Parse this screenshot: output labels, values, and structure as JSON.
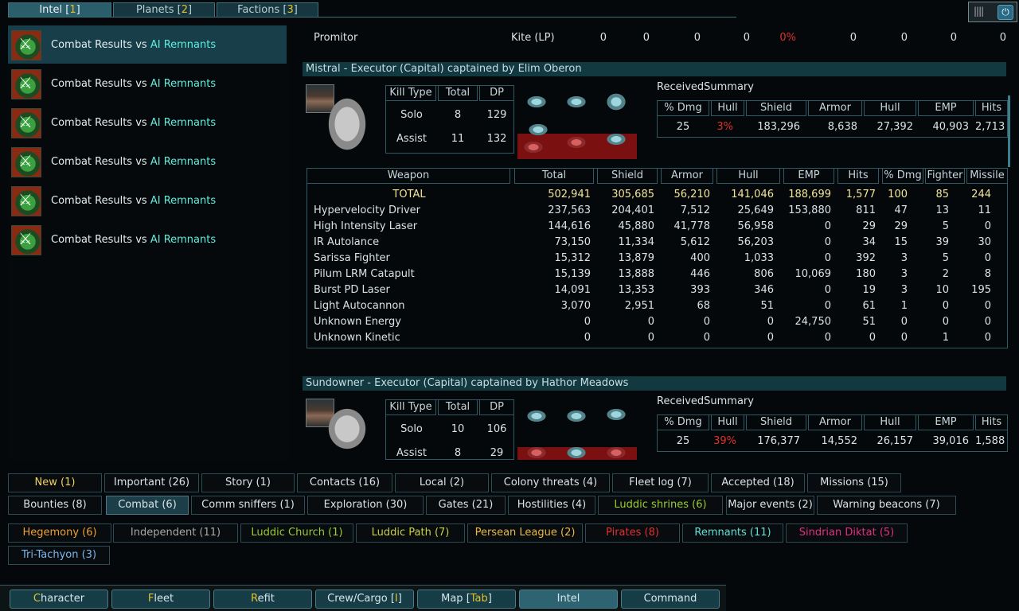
{
  "top_tabs": [
    {
      "label": "Intel [",
      "key": "1",
      "end": "]"
    },
    {
      "label": "Planets [",
      "key": "2",
      "end": "]"
    },
    {
      "label": "Factions [",
      "key": "3",
      "end": "]"
    }
  ],
  "intel_list": [
    {
      "prefix": "Combat Results vs ",
      "faction": "AI Remnants"
    },
    {
      "prefix": "Combat Results vs ",
      "faction": "AI Remnants"
    },
    {
      "prefix": "Combat Results vs ",
      "faction": "AI Remnants"
    },
    {
      "prefix": "Combat Results vs ",
      "faction": "AI Remnants"
    },
    {
      "prefix": "Combat Results vs ",
      "faction": "AI Remnants"
    },
    {
      "prefix": "Combat Results vs ",
      "faction": "AI Remnants"
    }
  ],
  "prev_row": {
    "name": "Promitor",
    "hull": "Kite (LP)",
    "v1": "0",
    "v2": "0",
    "v3": "0",
    "v4": "0",
    "pct": "0%",
    "v5": "0",
    "v6": "0",
    "v7": "0",
    "v8": "0"
  },
  "ship1": {
    "title": "Mistral - Executor (Capital) captained by Elim Oberon",
    "kill_headers": [
      "Kill Type",
      "Total",
      "DP"
    ],
    "kills": [
      {
        "type": "Solo",
        "total": "8",
        "dp": "129"
      },
      {
        "type": "Assist",
        "total": "11",
        "dp": "132"
      }
    ],
    "received_title": "ReceivedSummary",
    "received_headers": [
      "% Dmg",
      "Hull",
      "Shield",
      "Armor",
      "Hull",
      "EMP",
      "Hits"
    ],
    "received": [
      "25",
      "3%",
      "183,296",
      "8,638",
      "27,392",
      "40,903",
      "2,713"
    ],
    "weapon_headers": [
      "Weapon",
      "Total",
      "Shield",
      "Armor",
      "Hull",
      "EMP",
      "Hits",
      "% Dmg",
      "Fighter",
      "Missile"
    ],
    "weapons": [
      [
        "TOTAL",
        "502,941",
        "305,685",
        "56,210",
        "141,046",
        "188,699",
        "1,577",
        "100",
        "85",
        "244"
      ],
      [
        "Hypervelocity Driver",
        "237,563",
        "204,401",
        "7,512",
        "25,649",
        "153,880",
        "811",
        "47",
        "13",
        "11"
      ],
      [
        "High Intensity Laser",
        "144,616",
        "45,880",
        "41,778",
        "56,958",
        "0",
        "29",
        "29",
        "5",
        "0"
      ],
      [
        "IR Autolance",
        "73,150",
        "11,334",
        "5,612",
        "56,203",
        "0",
        "34",
        "15",
        "39",
        "30"
      ],
      [
        "Sarissa Fighter",
        "15,312",
        "13,879",
        "400",
        "1,033",
        "0",
        "392",
        "3",
        "5",
        "0"
      ],
      [
        "Pilum LRM Catapult",
        "15,139",
        "13,888",
        "446",
        "806",
        "10,069",
        "180",
        "3",
        "2",
        "8"
      ],
      [
        "Burst PD Laser",
        "14,091",
        "13,353",
        "393",
        "346",
        "0",
        "19",
        "3",
        "10",
        "195"
      ],
      [
        "Light Autocannon",
        "3,070",
        "2,951",
        "68",
        "51",
        "0",
        "61",
        "1",
        "0",
        "0"
      ],
      [
        "Unknown Energy",
        "0",
        "0",
        "0",
        "0",
        "24,750",
        "51",
        "0",
        "0",
        "0"
      ],
      [
        "Unknown Kinetic",
        "0",
        "0",
        "0",
        "0",
        "0",
        "0",
        "0",
        "1",
        "0"
      ]
    ]
  },
  "ship2": {
    "title": "Sundowner - Executor (Capital) captained by Hathor Meadows",
    "kill_headers": [
      "Kill Type",
      "Total",
      "DP"
    ],
    "kills": [
      {
        "type": "Solo",
        "total": "10",
        "dp": "106"
      },
      {
        "type": "Assist",
        "total": "8",
        "dp": "29"
      }
    ],
    "received_title": "ReceivedSummary",
    "received_headers": [
      "% Dmg",
      "Hull",
      "Shield",
      "Armor",
      "Hull",
      "EMP",
      "Hits"
    ],
    "received": [
      "25",
      "39%",
      "176,377",
      "14,552",
      "26,157",
      "39,016",
      "1,588"
    ]
  },
  "filters_row1": [
    {
      "label": "New (1)",
      "color": "#f0d060"
    },
    {
      "label": "Important (26)",
      "color": "#d9e3e6"
    },
    {
      "label": "Story (1)",
      "color": "#d9e3e6"
    },
    {
      "label": "Contacts (16)",
      "color": "#d9e3e6"
    },
    {
      "label": "Local (2)",
      "color": "#d9e3e6"
    },
    {
      "label": "Colony threats (4)",
      "color": "#d9e3e6"
    },
    {
      "label": "Fleet log (7)",
      "color": "#d9e3e6"
    },
    {
      "label": "Accepted (18)",
      "color": "#d9e3e6"
    },
    {
      "label": "Missions (15)",
      "color": "#d9e3e6"
    }
  ],
  "filters_row2": [
    {
      "label": "Bounties (8)",
      "color": "#d9e3e6"
    },
    {
      "label": "Combat (6)",
      "color": "#d9e3e6"
    },
    {
      "label": "Comm sniffers (1)",
      "color": "#d9e3e6"
    },
    {
      "label": "Exploration (30)",
      "color": "#d9e3e6"
    },
    {
      "label": "Gates (21)",
      "color": "#d9e3e6"
    },
    {
      "label": "Hostilities (4)",
      "color": "#d9e3e6"
    },
    {
      "label": "Luddic shrines (6)",
      "color": "#9acd32"
    },
    {
      "label": "Major events (2)",
      "color": "#d9e3e6"
    },
    {
      "label": "Warning beacons (7)",
      "color": "#d9e3e6"
    }
  ],
  "factions_row1": [
    {
      "label": "Hegemony (6)",
      "color": "#f0a030"
    },
    {
      "label": "Independent (11)",
      "color": "#a8a8a8"
    },
    {
      "label": "Luddic Church (1)",
      "color": "#9acd32"
    },
    {
      "label": "Luddic Path (7)",
      "color": "#c8d040"
    },
    {
      "label": "Persean League (2)",
      "color": "#e8b840"
    },
    {
      "label": "Pirates (8)",
      "color": "#e03030"
    },
    {
      "label": "Remnants (11)",
      "color": "#60e0d8"
    },
    {
      "label": "Sindrian Diktat (5)",
      "color": "#e03080"
    }
  ],
  "factions_row2": [
    {
      "label": "Tri-Tachyon (3)",
      "color": "#7ab8f0"
    }
  ],
  "bottom_tabs": [
    {
      "pre": "",
      "key": "C",
      "post": "haracter"
    },
    {
      "pre": "",
      "key": "F",
      "post": "leet"
    },
    {
      "pre": "",
      "key": "R",
      "post": "efit"
    },
    {
      "pre": "Crew/Cargo [",
      "key": "I",
      "post": "]"
    },
    {
      "pre": "Map [",
      "key": "Tab",
      "post": "]"
    },
    {
      "pre": "Intel",
      "key": "",
      "post": ""
    },
    {
      "pre": "Command",
      "key": "",
      "post": ""
    }
  ],
  "colors": {
    "accent": "#2a5e6a",
    "panel": "#123840",
    "red": "#e0312a",
    "total": "#f2e49a"
  }
}
